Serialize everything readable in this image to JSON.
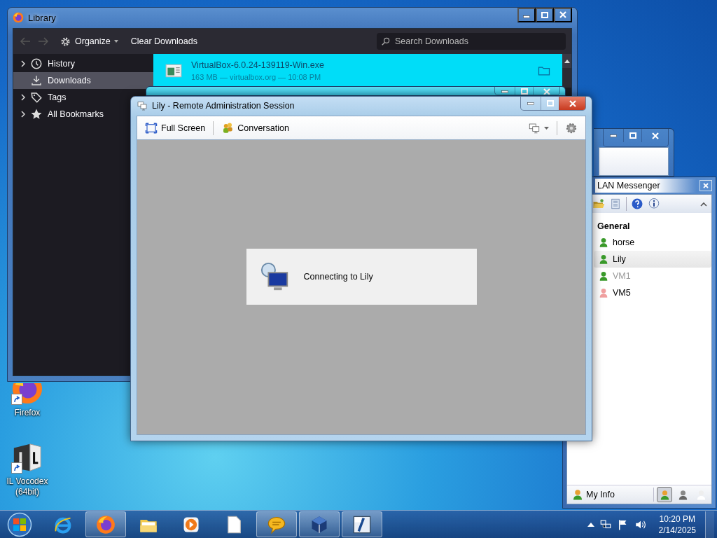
{
  "desktop_icons": [
    {
      "label": "Firefox",
      "kind": "firefox"
    },
    {
      "label": "IL Vocodex (64bit)",
      "kind": "vocodex"
    }
  ],
  "library": {
    "title": "Library",
    "organize": "Organize",
    "clear_downloads": "Clear Downloads",
    "search_placeholder": "Search Downloads",
    "sidebar": [
      {
        "label": "History",
        "kind": "history",
        "expandable": true,
        "selected": false
      },
      {
        "label": "Downloads",
        "kind": "downloads",
        "expandable": false,
        "selected": true
      },
      {
        "label": "Tags",
        "kind": "tags",
        "expandable": true,
        "selected": false
      },
      {
        "label": "All Bookmarks",
        "kind": "bookmarks",
        "expandable": true,
        "selected": false
      }
    ],
    "downloads": [
      {
        "name": "VirtualBox-6.0.24-139119-Win.exe",
        "details": "163 MB — virtualbox.org — 10:08 PM",
        "selected": true
      }
    ]
  },
  "remote_session": {
    "title": "Lily - Remote Administration Session",
    "toolbar": [
      {
        "label": "Full Screen",
        "kind": "fullscreen"
      },
      {
        "label": "Conversation",
        "kind": "conversation"
      }
    ],
    "message": "Connecting to Lily"
  },
  "messenger": {
    "title": "LAN Messenger",
    "group": "General",
    "contacts": [
      {
        "name": "horse",
        "color": "#3a9a2a",
        "greyed": false,
        "selected": false
      },
      {
        "name": "Lily",
        "color": "#3a9a2a",
        "greyed": false,
        "selected": true
      },
      {
        "name": "VM1",
        "color": "#3a9a2a",
        "greyed": true,
        "selected": false
      },
      {
        "name": "VM5",
        "color": "#f0a0a0",
        "greyed": false,
        "selected": false
      }
    ],
    "my_info": "My Info",
    "status_buttons": [
      {
        "kind": "available",
        "selected": true
      },
      {
        "kind": "busy",
        "selected": false
      },
      {
        "kind": "offline",
        "selected": false
      }
    ]
  },
  "taskbar": {
    "apps": [
      {
        "kind": "ie",
        "running": false
      },
      {
        "kind": "firefox",
        "running": true
      },
      {
        "kind": "explorer",
        "running": false
      },
      {
        "kind": "media",
        "running": false
      },
      {
        "kind": "document",
        "running": false
      },
      {
        "kind": "messenger",
        "running": true
      },
      {
        "kind": "virtualbox",
        "running": true
      },
      {
        "kind": "vocodex",
        "running": true
      }
    ],
    "time": "10:20 PM",
    "date": "2/14/2025"
  }
}
